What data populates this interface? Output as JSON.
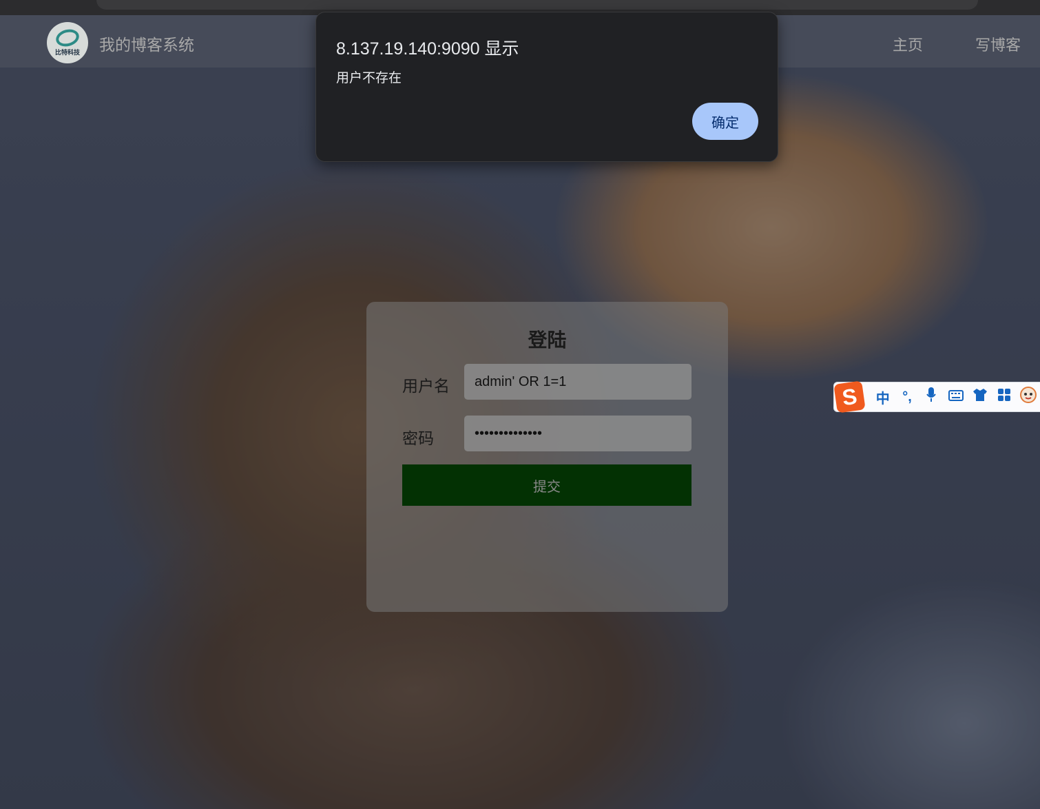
{
  "navbar": {
    "logo_text": "比特科技",
    "site_title": "我的博客系统",
    "links": [
      "主页",
      "写博客"
    ]
  },
  "dialog": {
    "title": "8.137.19.140:9090 显示",
    "message": "用户不存在",
    "ok_label": "确定"
  },
  "login": {
    "title": "登陆",
    "username_label": "用户名",
    "username_value": "admin' OR 1=1",
    "password_label": "密码",
    "password_value": "••••••••••••••",
    "submit_label": "提交"
  },
  "ime": {
    "logo": "S",
    "mode": "中",
    "punct": "°,",
    "icons": [
      "microphone-icon",
      "keyboard-icon",
      "skin-icon",
      "toolbox-icon",
      "mascot-icon"
    ]
  }
}
